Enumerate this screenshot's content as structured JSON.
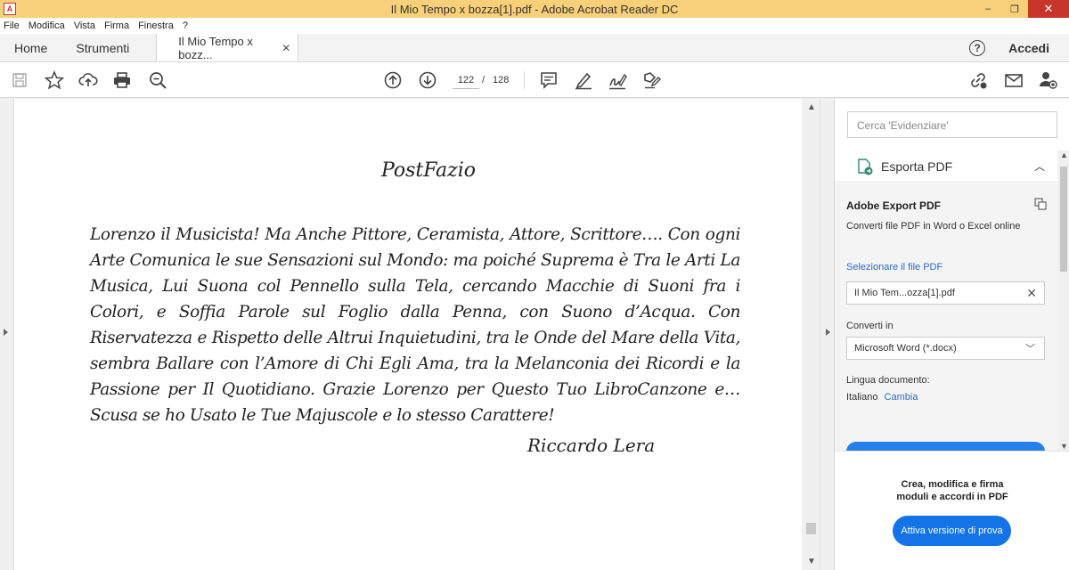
{
  "window": {
    "title": "Il Mio Tempo x bozza[1].pdf - Adobe Acrobat Reader DC",
    "app_icon": "acrobat-icon",
    "minimize": "‒",
    "maximize": "❐",
    "close": "✕"
  },
  "menu": [
    "File",
    "Modifica",
    "Vista",
    "Firma",
    "Finestra",
    "?"
  ],
  "tabs": {
    "home": "Home",
    "tools": "Strumenti",
    "document": "Il Mio Tempo x bozz...",
    "close": "✕"
  },
  "header": {
    "help": "?",
    "signin": "Accedi"
  },
  "toolbar": {
    "current_page": "122",
    "separator": "/",
    "total_pages": "128"
  },
  "document": {
    "title": "PostFazio",
    "body": "Lorenzo il Musicista! Ma Anche Pittore, Ceramista, Attore, Scrittore…. Con ogni Arte Comunica le sue Sensazioni sul Mondo: ma poiché Suprema è Tra le Arti La Musica, Lui Suona col Pennello sulla Tela, cercando Macchie di Suoni fra i Colori, e Soffia Parole sul Foglio dalla Penna, con Suono d’Acqua. Con Riservatezza e Rispetto delle Altrui Inquietudini, tra le Onde del Mare della Vita, sembra Ballare con l’Amore di Chi Egli Ama, tra la Melanconia dei Ricordi e la Passione per Il Quotidiano. Grazie Lorenzo per Questo Tuo LibroCanzone e… Scusa se ho Usato le Tue Majuscole e lo stesso Carattere!",
    "signature": "Riccardo Lera"
  },
  "right_panel": {
    "search_placeholder": "Cerca 'Evidenziare'",
    "export_label": "Esporta PDF",
    "export_title": "Adobe Export PDF",
    "export_desc": "Converti file PDF in Word o Excel online",
    "select_file_link": "Selezionare il file PDF",
    "file_name": "Il Mio Tem...ozza[1].pdf",
    "convert_label": "Converti in",
    "format_value": "Microsoft Word (*.docx)",
    "language_label": "Lingua documento:",
    "language_value": "Italiano",
    "language_change": "Cambia",
    "promo_line1": "Crea, modifica e firma",
    "promo_line2": "moduli e accordi in PDF",
    "promo_button": "Attiva versione di prova"
  },
  "colors": {
    "titlebar": "#f8d07a",
    "close_button": "#c7352b",
    "link": "#2b6cc4",
    "primary_button": "#1473e6"
  }
}
